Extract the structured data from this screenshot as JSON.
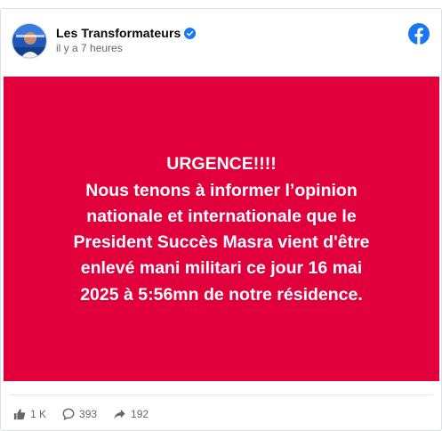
{
  "post": {
    "author": "Les Transformateurs",
    "timestamp": "il y a 7 heures",
    "verified": true,
    "platform_icon": "facebook-icon"
  },
  "image": {
    "background_color": "#e1003b",
    "lines": [
      "URGENCE!!!!",
      "Nous tenons à informer l’opinion",
      "nationale et internationale que le",
      "President Succès Masra vient d'être",
      "enlevé mani militari ce jour 16 mai",
      "2025 à 5:56mn de notre résidence."
    ]
  },
  "stats": {
    "likes": "1 K",
    "comments": "393",
    "shares": "192"
  },
  "colors": {
    "facebook_blue": "#1877f2",
    "verified_blue": "#1877f2",
    "muted_text": "#65676b"
  }
}
